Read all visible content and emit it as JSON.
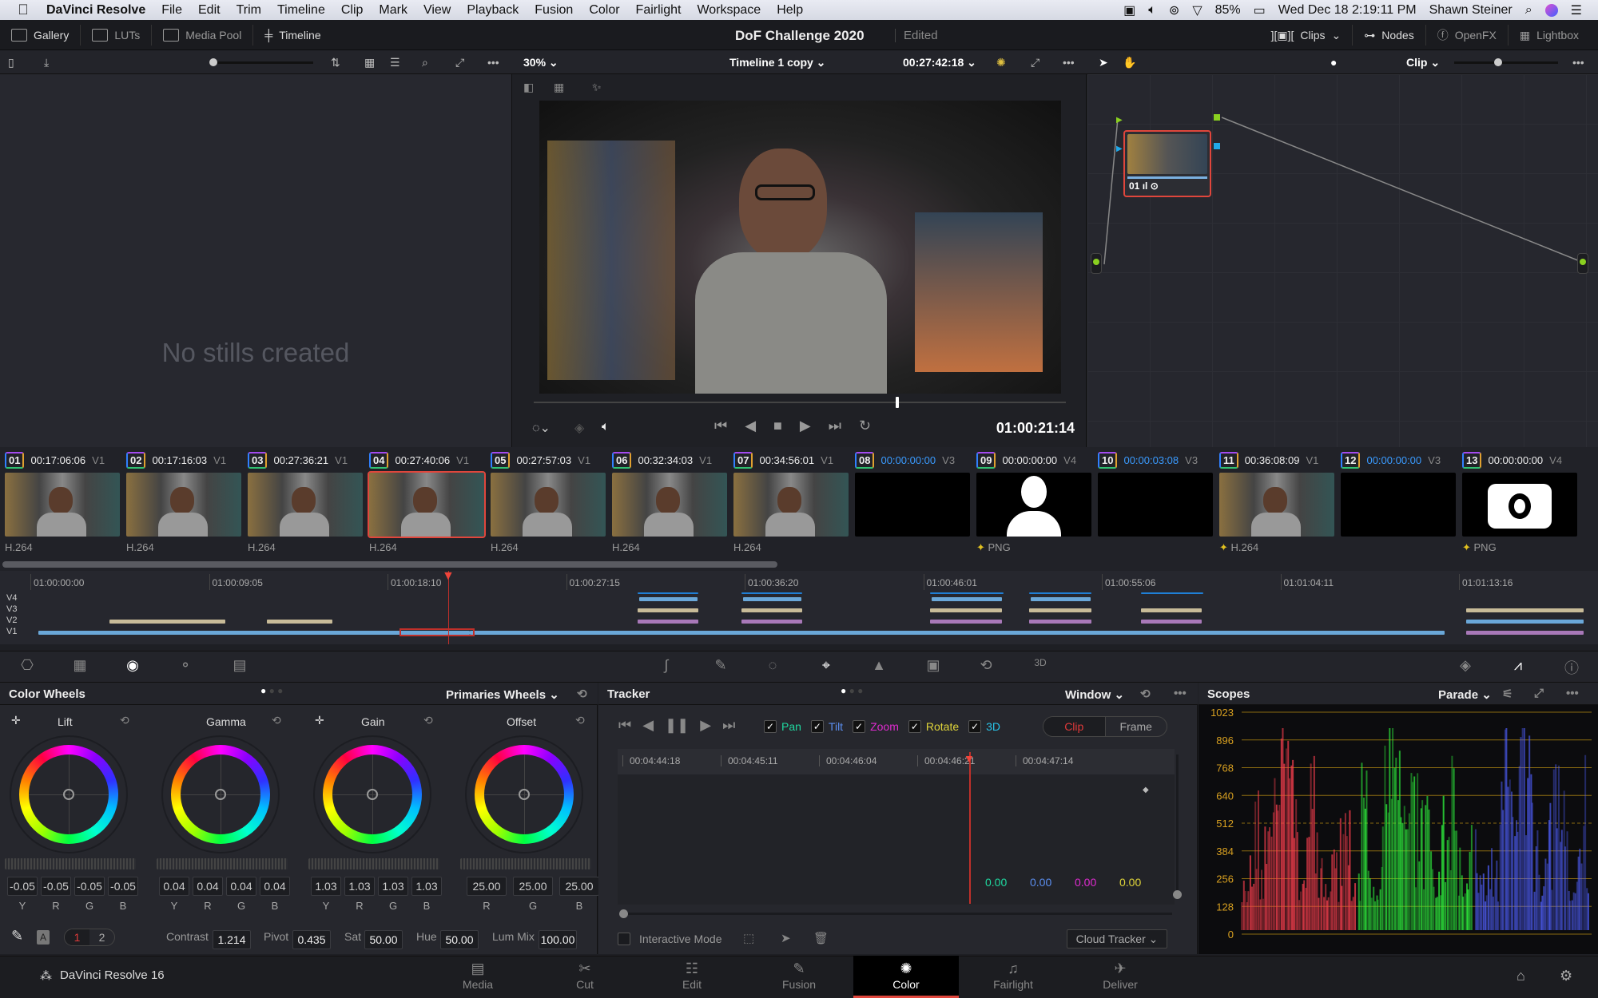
{
  "menubar": {
    "app": "DaVinci Resolve",
    "items": [
      "File",
      "Edit",
      "Trim",
      "Timeline",
      "Clip",
      "Mark",
      "View",
      "Playback",
      "Fusion",
      "Color",
      "Fairlight",
      "Workspace",
      "Help"
    ],
    "battery": "85%",
    "datetime": "Wed Dec 18  2:19:11 PM",
    "user": "Shawn Steiner"
  },
  "topbar": {
    "left": [
      "Gallery",
      "LUTs",
      "Media Pool",
      "Timeline"
    ],
    "project_title": "DoF Challenge 2020",
    "project_status": "Edited",
    "right": [
      "Clips",
      "Nodes",
      "OpenFX",
      "Lightbox"
    ]
  },
  "viewer": {
    "zoom": "30%",
    "timeline_name": "Timeline 1 copy",
    "source_tc": "00:27:42:18",
    "timecode": "01:00:21:14",
    "scrub_position": 0.68
  },
  "nodes": {
    "mode": "Clip",
    "node_label": "01"
  },
  "gallery": {
    "empty_text": "No stills created"
  },
  "clips": [
    {
      "num": "01",
      "tc": "00:17:06:06",
      "track": "V1",
      "codec": "H.264",
      "blue": false,
      "type": "video"
    },
    {
      "num": "02",
      "tc": "00:17:16:03",
      "track": "V1",
      "codec": "H.264",
      "blue": false,
      "type": "video"
    },
    {
      "num": "03",
      "tc": "00:27:36:21",
      "track": "V1",
      "codec": "H.264",
      "blue": false,
      "type": "video"
    },
    {
      "num": "04",
      "tc": "00:27:40:06",
      "track": "V1",
      "codec": "H.264",
      "blue": false,
      "type": "video",
      "selected": true
    },
    {
      "num": "05",
      "tc": "00:27:57:03",
      "track": "V1",
      "codec": "H.264",
      "blue": false,
      "type": "video"
    },
    {
      "num": "06",
      "tc": "00:32:34:03",
      "track": "V1",
      "codec": "H.264",
      "blue": false,
      "type": "video"
    },
    {
      "num": "07",
      "tc": "00:34:56:01",
      "track": "V1",
      "codec": "H.264",
      "blue": false,
      "type": "video"
    },
    {
      "num": "08",
      "tc": "00:00:00:00",
      "track": "V3",
      "codec": "",
      "blue": true,
      "type": "black"
    },
    {
      "num": "09",
      "tc": "00:00:00:00",
      "track": "V4",
      "codec": "PNG",
      "blue": false,
      "type": "person"
    },
    {
      "num": "10",
      "tc": "00:00:03:08",
      "track": "V3",
      "codec": "",
      "blue": true,
      "type": "black"
    },
    {
      "num": "11",
      "tc": "00:36:08:09",
      "track": "V1",
      "codec": "H.264",
      "blue": false,
      "type": "video"
    },
    {
      "num": "12",
      "tc": "00:00:00:00",
      "track": "V3",
      "codec": "",
      "blue": true,
      "type": "black"
    },
    {
      "num": "13",
      "tc": "00:00:00:00",
      "track": "V4",
      "codec": "PNG",
      "blue": false,
      "type": "camera"
    }
  ],
  "mini_timeline": {
    "ticks": [
      "01:00:00:00",
      "01:00:09:05",
      "01:00:18:10",
      "01:00:27:15",
      "01:00:36:20",
      "01:00:46:01",
      "01:00:55:06",
      "01:01:04:11",
      "01:01:13:16"
    ],
    "tracks": [
      "V4",
      "V3",
      "V2",
      "V1"
    ]
  },
  "color_wheels": {
    "title": "Color Wheels",
    "mode": "Primaries Wheels",
    "wheels": [
      {
        "name": "Lift",
        "values": [
          "-0.05",
          "-0.05",
          "-0.05",
          "-0.05"
        ],
        "labels": [
          "Y",
          "R",
          "G",
          "B"
        ]
      },
      {
        "name": "Gamma",
        "values": [
          "0.04",
          "0.04",
          "0.04",
          "0.04"
        ],
        "labels": [
          "Y",
          "R",
          "G",
          "B"
        ]
      },
      {
        "name": "Gain",
        "values": [
          "1.03",
          "1.03",
          "1.03",
          "1.03"
        ],
        "labels": [
          "Y",
          "R",
          "G",
          "B"
        ]
      },
      {
        "name": "Offset",
        "values": [
          "25.00",
          "25.00",
          "25.00"
        ],
        "labels": [
          "R",
          "G",
          "B"
        ]
      }
    ],
    "page_1": "1",
    "page_2": "2",
    "contrast_label": "Contrast",
    "contrast": "1.214",
    "pivot_label": "Pivot",
    "pivot": "0.435",
    "sat_label": "Sat",
    "sat": "50.00",
    "hue_label": "Hue",
    "hue": "50.00",
    "lummix_label": "Lum Mix",
    "lummix": "100.00"
  },
  "tracker": {
    "title": "Tracker",
    "mode": "Window",
    "options": [
      {
        "label": "Pan",
        "color": "#1fd9a0",
        "checked": true
      },
      {
        "label": "Tilt",
        "color": "#5b8ef0",
        "checked": true
      },
      {
        "label": "Zoom",
        "color": "#e02bd0",
        "checked": true
      },
      {
        "label": "Rotate",
        "color": "#e0d53a",
        "checked": true
      },
      {
        "label": "3D",
        "color": "#29c3e8",
        "checked": true
      }
    ],
    "clip_label": "Clip",
    "frame_label": "Frame",
    "ticks": [
      "00:04:44:18",
      "00:04:45:11",
      "00:04:46:04",
      "00:04:46:21",
      "00:04:47:14"
    ],
    "readouts": [
      {
        "value": "0.00",
        "color": "#1fd9a0"
      },
      {
        "value": "0.00",
        "color": "#5b8ef0"
      },
      {
        "value": "0.00",
        "color": "#e02bd0"
      },
      {
        "value": "0.00",
        "color": "#e0d53a"
      }
    ],
    "interactive_mode": "Interactive Mode",
    "cloud_tracker": "Cloud Tracker"
  },
  "scopes": {
    "title": "Scopes",
    "mode": "Parade",
    "axis": [
      "1023",
      "896",
      "768",
      "640",
      "512",
      "384",
      "256",
      "128",
      "0"
    ]
  },
  "nav": {
    "brand": "DaVinci Resolve 16",
    "pages": [
      "Media",
      "Cut",
      "Edit",
      "Fusion",
      "Color",
      "Fairlight",
      "Deliver"
    ],
    "active": "Color"
  }
}
